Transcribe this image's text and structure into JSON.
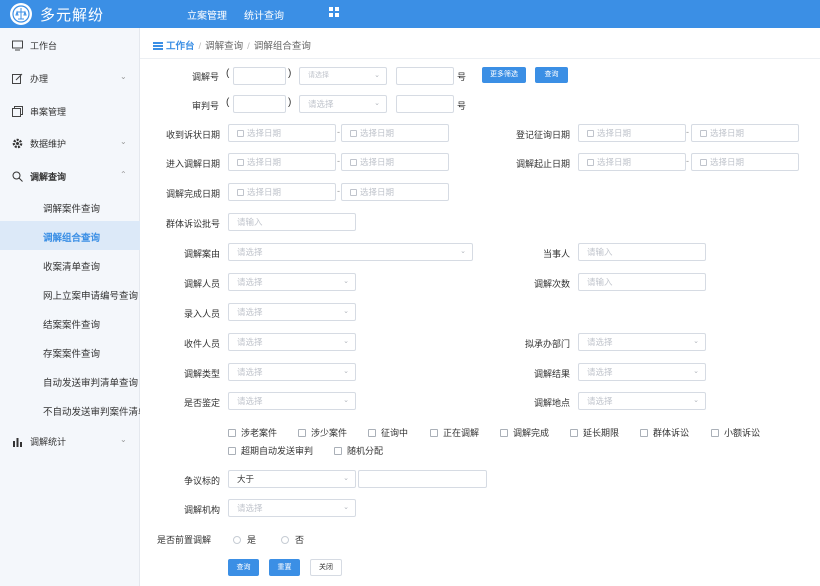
{
  "app": {
    "title": "多元解纷"
  },
  "topnav": [
    "立案管理",
    "统计查询"
  ],
  "sidebar": {
    "items": [
      {
        "label": "工作台",
        "chevron": ""
      },
      {
        "label": "办理",
        "chevron": "⌄"
      },
      {
        "label": "串案管理",
        "chevron": ""
      },
      {
        "label": "数据维护",
        "chevron": "⌄"
      },
      {
        "label": "调解查询",
        "chevron": "⌃"
      },
      {
        "label": "调解统计",
        "chevron": "⌄"
      }
    ],
    "sub_items": [
      "调解案件查询",
      "调解组合查询",
      "收案清单查询",
      "网上立案申请编号查询",
      "结案案件查询",
      "存案案件查询",
      "自动发送审判清单查询",
      "不自动发送审判案件清单查询"
    ]
  },
  "breadcrumb": {
    "home": "工作台",
    "parts": [
      "调解查询",
      "调解组合查询"
    ]
  },
  "form": {
    "mediation_no": {
      "label": "调解号",
      "open": "(",
      "close": ")",
      "select_placeholder": "请选择",
      "suffix": "号",
      "more_filters": "更多筛选",
      "query": "查询"
    },
    "trial_no": {
      "label": "审判号",
      "open": "(",
      "close": ")",
      "select_placeholder": "请选择",
      "suffix": "号"
    },
    "date_placeholder": "选择日期",
    "input_placeholder": "请输入",
    "select_placeholder": "请选择",
    "dash": "-",
    "labels": {
      "received_date": "收到诉状日期",
      "register_date": "登记征询日期",
      "enter_date": "进入调解日期",
      "start_end_date": "调解起止日期",
      "complete_date": "调解完成日期",
      "group_batch": "群体诉讼批号",
      "cause": "调解案由",
      "party": "当事人",
      "mediator": "调解人员",
      "count": "调解次数",
      "entry_person": "录入人员",
      "receiver": "收件人员",
      "dept": "拟承办部门",
      "type": "调解类型",
      "result": "调解结果",
      "appraisal": "是否鉴定",
      "location": "调解地点",
      "amount": "争议标的",
      "org": "调解机构",
      "pre_mediation": "是否前置调解"
    },
    "amount_op": "大于",
    "checkboxes": [
      "涉老案件",
      "涉少案件",
      "征询中",
      "正在调解",
      "调解完成",
      "延长期限",
      "群体诉讼",
      "小额诉讼",
      "超期自动发送审判",
      "随机分配"
    ],
    "radios": [
      "是",
      "否"
    ],
    "buttons": {
      "query": "查询",
      "reset": "重置",
      "close": "关闭"
    },
    "arrow": "⌄"
  }
}
